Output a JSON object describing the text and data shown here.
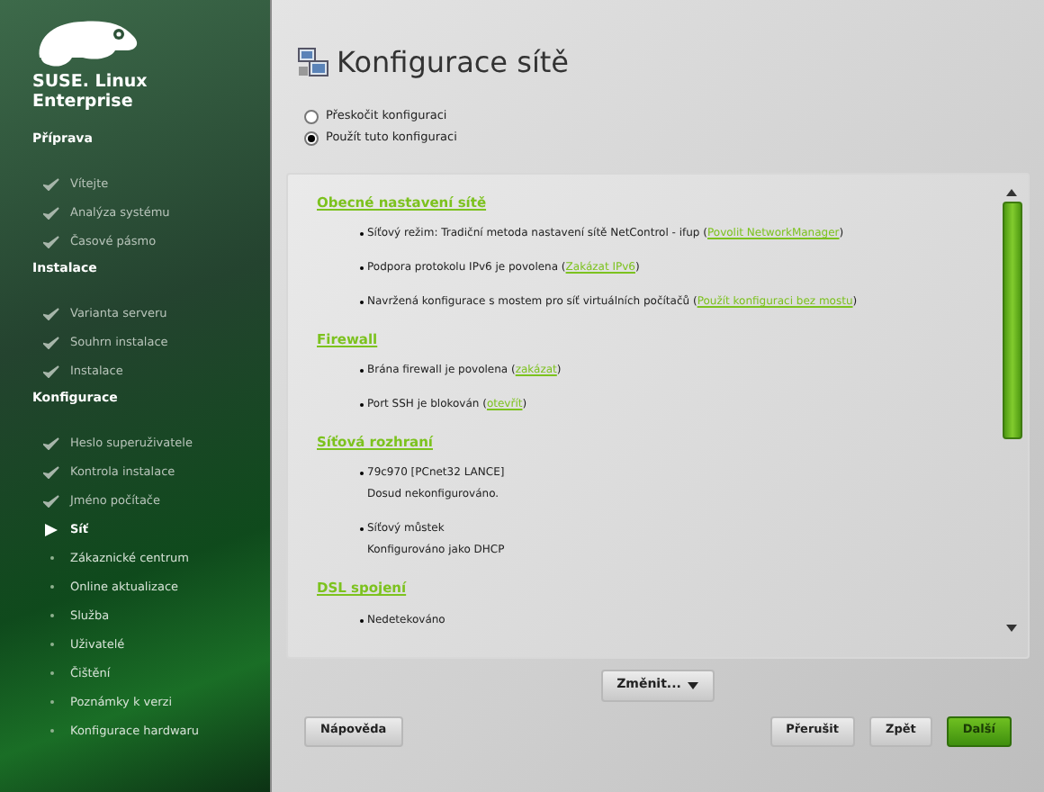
{
  "brand": {
    "name": "SUSE. Linux",
    "product": "Enterprise"
  },
  "sidebar": {
    "sections": [
      {
        "title": "Příprava",
        "items": [
          {
            "label": "Vítejte",
            "kind": "done",
            "selected": false
          },
          {
            "label": "Analýza systému",
            "kind": "done",
            "selected": false
          },
          {
            "label": "Časové pásmo",
            "kind": "done",
            "selected": false
          }
        ]
      },
      {
        "title": "Instalace",
        "items": [
          {
            "label": "Varianta serveru",
            "kind": "done",
            "selected": false
          },
          {
            "label": "Souhrn instalace",
            "kind": "done",
            "selected": false
          },
          {
            "label": "Instalace",
            "kind": "done",
            "selected": false
          }
        ]
      },
      {
        "title": "Konfigurace",
        "items": [
          {
            "label": "Heslo superuživatele",
            "kind": "done",
            "selected": false
          },
          {
            "label": "Kontrola instalace",
            "kind": "done",
            "selected": false
          },
          {
            "label": "Jméno počítače",
            "kind": "done",
            "selected": false
          },
          {
            "label": "Síť",
            "kind": "current",
            "selected": true
          },
          {
            "label": "Zákaznické centrum",
            "kind": "todo",
            "selected": false
          },
          {
            "label": "Online aktualizace",
            "kind": "todo",
            "selected": false
          },
          {
            "label": "Služba",
            "kind": "todo",
            "selected": false
          },
          {
            "label": "Uživatelé",
            "kind": "todo",
            "selected": false
          },
          {
            "label": "Čištění",
            "kind": "todo",
            "selected": false
          },
          {
            "label": "Poznámky k verzi",
            "kind": "todo",
            "selected": false
          },
          {
            "label": "Konfigurace hardwaru",
            "kind": "todo",
            "selected": false
          }
        ]
      }
    ]
  },
  "title": "Konfigurace sítě",
  "options": [
    {
      "label": "Přeskočit konfiguraci",
      "selected": false
    },
    {
      "label": "Použít tuto konfiguraci",
      "selected": true
    }
  ],
  "summary": [
    {
      "heading": "Obecné nastavení sítě",
      "items": [
        {
          "text": "Síťový režim: Tradiční metoda nastavení sítě NetControl - ifup (",
          "link": "Povolit NetworkManager",
          "after": ")"
        },
        {
          "text": "Podpora protokolu IPv6 je povolena (",
          "link": "Zakázat IPv6",
          "after": ")"
        },
        {
          "text": "Navržená konfigurace s mostem pro síť virtuálních počítačů (",
          "link": "Použít konfiguraci bez mostu",
          "after": ")"
        }
      ]
    },
    {
      "heading": "Firewall",
      "items": [
        {
          "text": "Brána firewall je povolena (",
          "link": "zakázat",
          "after": ")"
        },
        {
          "text": "Port SSH je blokován (",
          "link": "otevřít",
          "after": ")"
        }
      ]
    },
    {
      "heading": "Síťová rozhraní",
      "items": [
        {
          "text": "79c970 [PCnet32 LANCE]",
          "detail": "Dosud nekonfigurováno."
        },
        {
          "text": "Síťový můstek",
          "detail": "Konfigurováno jako DHCP"
        }
      ]
    },
    {
      "heading": "DSL spojení",
      "items": [
        {
          "text": "Nedetekováno"
        }
      ]
    }
  ],
  "change_button": "Změnit...",
  "buttons": {
    "help": "Nápověda",
    "abort": "Přerušit",
    "back": "Zpět",
    "next": "Další"
  }
}
